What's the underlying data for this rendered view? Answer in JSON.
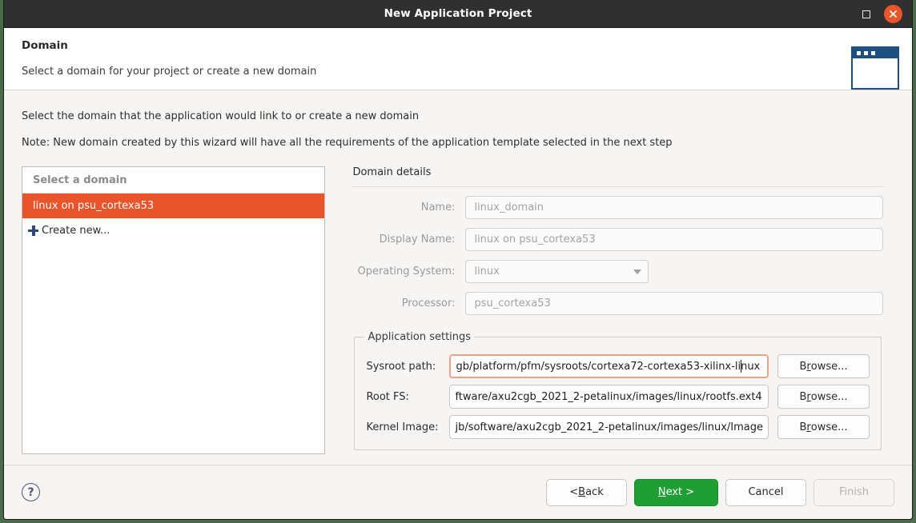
{
  "window": {
    "title": "New Application Project",
    "controls": {
      "maximize": "maximize-icon",
      "close": "close-icon"
    }
  },
  "header": {
    "title": "Domain",
    "subtitle": "Select a domain for your project or create a new domain",
    "icon": "wizard-window-icon"
  },
  "intro": {
    "line1": "Select the domain that the application would link to or create a new domain",
    "line2": "Note: New domain created by this wizard will have all the requirements of the application template selected in the next step"
  },
  "domain_list": {
    "header": "Select a domain",
    "items": [
      {
        "label": "linux on psu_cortexa53",
        "selected": true,
        "icon": null
      },
      {
        "label": "Create new...",
        "selected": false,
        "icon": "plus-icon"
      }
    ]
  },
  "details": {
    "section_title": "Domain details",
    "fields": [
      {
        "label": "Name:",
        "value": "linux_domain",
        "type": "text"
      },
      {
        "label": "Display Name:",
        "value": "linux on psu_cortexa53",
        "type": "text"
      },
      {
        "label": "Operating System:",
        "value": "linux",
        "type": "combo"
      },
      {
        "label": "Processor:",
        "value": "psu_cortexa53",
        "type": "text"
      }
    ]
  },
  "app_settings": {
    "legend": "Application settings",
    "browse_label_pre": "B",
    "browse_label_mnemonic": "r",
    "browse_label_post": "owse...",
    "rows": [
      {
        "label": "Sysroot path:",
        "value_before_caret": "gb/platform/pfm/sysroots/cortexa72-cortexa53-xilinx-li",
        "value_after_caret": "nux",
        "focused": true,
        "browse": "Browse..."
      },
      {
        "label": "Root FS:",
        "value_before_caret": "ftware/axu2cgb_2021_2-petalinux/images/linux/rootfs.ext4",
        "value_after_caret": "",
        "focused": false,
        "browse": "Browse..."
      },
      {
        "label": "Kernel Image:",
        "value_before_caret": "jb/software/axu2cgb_2021_2-petalinux/images/linux/Image",
        "value_after_caret": "",
        "focused": false,
        "browse": "Browse..."
      }
    ]
  },
  "footer": {
    "help": "?",
    "buttons": [
      {
        "name": "back",
        "pre": "< ",
        "mnemonic": "B",
        "post": "ack",
        "style": "normal",
        "disabled": false
      },
      {
        "name": "next",
        "pre": "",
        "mnemonic": "N",
        "post": "ext >",
        "style": "primary",
        "disabled": false
      },
      {
        "name": "cancel",
        "pre": "Cancel",
        "mnemonic": "",
        "post": "",
        "style": "normal",
        "disabled": false
      },
      {
        "name": "finish",
        "pre": "Finish",
        "mnemonic": "",
        "post": "",
        "style": "normal",
        "disabled": true
      }
    ]
  },
  "colors": {
    "titlebar": "#303030",
    "close_button": "#e9562a",
    "selection": "#e9542a",
    "primary_button": "#1f9e34",
    "focus_border": "#f0a287",
    "desktop": "#4a6a4c",
    "icon_blue": "#1d5081"
  }
}
